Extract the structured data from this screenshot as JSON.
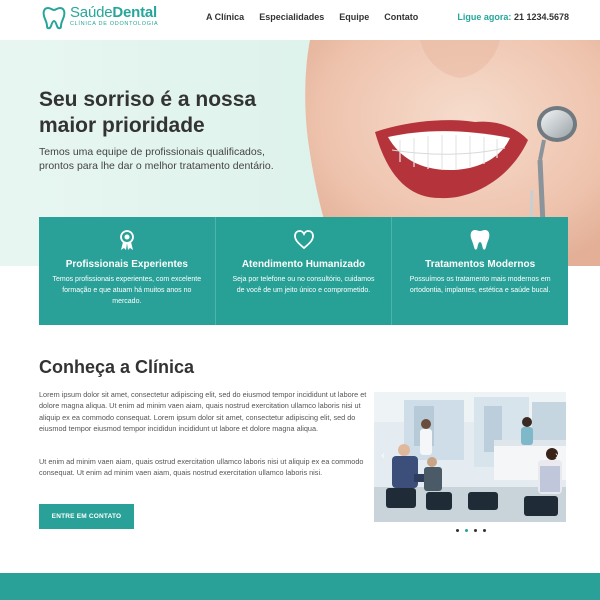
{
  "brand": {
    "name_light": "Saúde",
    "name_bold": "Dental",
    "tagline": "CLÍNICA DE ODONTOLOGIA",
    "accent": "#2aa198"
  },
  "nav": {
    "items": [
      {
        "label": "A Clínica"
      },
      {
        "label": "Especialidades"
      },
      {
        "label": "Equipe"
      },
      {
        "label": "Contato"
      }
    ]
  },
  "phone": {
    "label": "Ligue agora:",
    "number": "21 1234.5678"
  },
  "hero": {
    "title": "Seu sorriso é a nossa maior prioridade",
    "text": "Temos uma equipe de profissionais qualificados, prontos para lhe dar o melhor tratamento dentário."
  },
  "features": [
    {
      "icon": "award-ribbon-icon",
      "title": "Profissionais Experientes",
      "text": "Temos profissionais experientes, com excelente formação e que atuam há muitos anos no mercado."
    },
    {
      "icon": "heart-icon",
      "title": "Atendimento Humanizado",
      "text": "Seja por telefone ou no consultório, cuidamos de você de um jeito único e comprometido."
    },
    {
      "icon": "tooth-icon",
      "title": "Tratamentos Modernos",
      "text": "Possuímos os tratamento mais modernos em ortodontia, implantes, estética e saúde bucal."
    }
  ],
  "about": {
    "title": "Conheça a Clínica",
    "p1": "Lorem ipsum dolor sit amet, consectetur adipiscing elit, sed do eiusmod tempor incididunt ut labore et dolore magna aliqua. Ut enim ad minim vaen aiam, quais nostrud exercitation ullamco laboris nisi ut aliquip ex ea commodo consequat. Lorem ipsum dolor sit amet, consectetur adipiscing elit, sed do eiusmod tempor eiusmod tempor incididun incididunt ut labore et dolore magna aliqua.",
    "p2": "Ut enim ad minim vaen aiam, quais ostrud exercitation ullamco laboris nisi ut aliquip ex ea commodo consequat. Ut enim ad minim vaen aiam, quais nostrud exercitation ullamco laboris nisi.",
    "cta": "ENTRE EM CONTATO"
  },
  "carousel": {
    "prev": "‹",
    "next": "›",
    "slides": 4,
    "active_slide": 2
  }
}
